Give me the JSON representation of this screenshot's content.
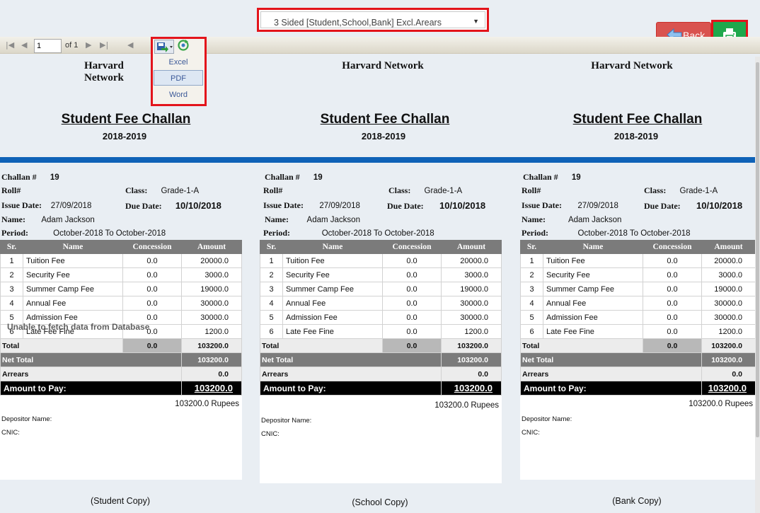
{
  "report_select": {
    "value": "3 Sided [Student,School,Bank] Excl.Arears"
  },
  "buttons": {
    "back_label": "Back",
    "print_icon": "printer-icon"
  },
  "toolbar": {
    "page_value": "1",
    "of_label": "of 1",
    "export_menu": [
      "Excel",
      "PDF",
      "Word"
    ]
  },
  "header": {
    "org": "Harvard Network",
    "title": "Student Fee Challan",
    "year": "2018-2019"
  },
  "labels": {
    "challan": "Challan #",
    "roll": "Roll#",
    "class": "Class:",
    "issue_date": "Issue Date:",
    "due_date": "Due Date:",
    "name": "Name:",
    "period": "Period:",
    "col_sr": "Sr.",
    "col_name": "Name",
    "col_concession": "Concession",
    "col_amount": "Amount",
    "total": "Total",
    "net_total": "Net Total",
    "arrears": "Arrears",
    "amount_to_pay": "Amount to Pay:",
    "depositor": "Depositor Name:",
    "cnic": "CNIC:"
  },
  "challan": {
    "number": "19",
    "class": "Grade-1-A",
    "issue_date": "27/09/2018",
    "due_date": "10/10/2018",
    "name": "Adam Jackson",
    "period": "October-2018 To October-2018",
    "fees": [
      {
        "sr": "1",
        "name": "Tuition Fee",
        "concession": "0.0",
        "amount": "20000.0"
      },
      {
        "sr": "2",
        "name": "Security Fee",
        "concession": "0.0",
        "amount": "3000.0"
      },
      {
        "sr": "3",
        "name": "Summer Camp Fee",
        "concession": "0.0",
        "amount": "19000.0"
      },
      {
        "sr": "4",
        "name": "Annual Fee",
        "concession": "0.0",
        "amount": "30000.0"
      },
      {
        "sr": "5",
        "name": "Admission Fee",
        "concession": "0.0",
        "amount": "30000.0"
      },
      {
        "sr": "6",
        "name": "Late Fee Fine",
        "concession": "0.0",
        "amount": "1200.0"
      }
    ],
    "total_concession": "0.0",
    "total_amount": "103200.0",
    "net_total": "103200.0",
    "arrears": "0.0",
    "amount_to_pay": "103200.0",
    "rupees": "103200.0 Rupees"
  },
  "copies": {
    "student": "(Student Copy)",
    "school": "(School Copy)",
    "bank": "(Bank Copy)"
  },
  "error_message": "Unable to fetch data from Database",
  "colors": {
    "accent_blue": "#0f62b7",
    "back_red": "#d9534f",
    "print_green": "#1fa84c",
    "highlight_red": "#e3141b"
  }
}
